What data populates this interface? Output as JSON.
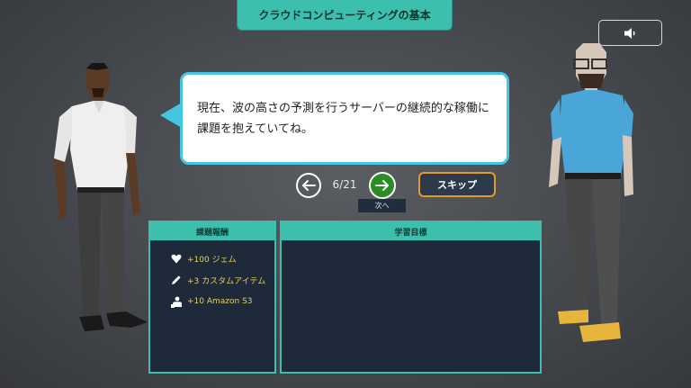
{
  "header": {
    "title": "クラウドコンピューティングの基本"
  },
  "dialogue": {
    "text": "現在、波の高さの予測を行うサーバーの継続的な稼働に課題を抱えていてね。"
  },
  "navigation": {
    "counter": "6/21",
    "next_tooltip": "次へ",
    "skip_label": "スキップ"
  },
  "rewards_panel": {
    "title": "課題報酬",
    "items": [
      {
        "icon": "gem-icon",
        "label": "+100 ジェム"
      },
      {
        "icon": "pencil-icon",
        "label": "+3 カスタムアイテム"
      },
      {
        "icon": "user-icon",
        "label": "+10 Amazon S3"
      }
    ]
  },
  "objectives_panel": {
    "title": "学習目標"
  },
  "colors": {
    "teal": "#3cc0ad",
    "bubble_border": "#44c6e3",
    "next_green": "#2c8c25",
    "skip_border": "#e19b2a",
    "reward_text": "#e5cf67",
    "panel_bg": "#1e2a39"
  }
}
